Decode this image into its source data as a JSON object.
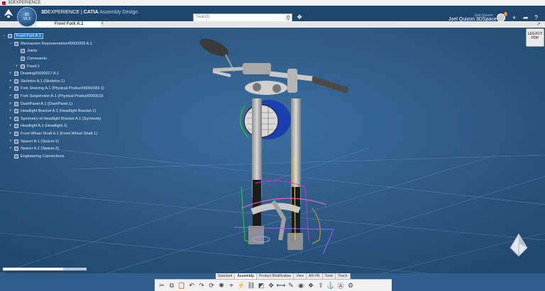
{
  "window_title": "3DEXPERIENCE",
  "header": {
    "brand_bold": "3D",
    "brand_rest": "EXPERIENCE",
    "separator": " | ",
    "product": "CATIA",
    "app": "Assembly Design",
    "app_badge": "3D\nV1.6",
    "search_placeholder": "Search",
    "user_small": "Joel Quizon",
    "user_name": "Joel Quizon 3DSpace",
    "notification_count": "1"
  },
  "tab": {
    "label": "Front Fork A.1"
  },
  "tree": {
    "root": "Front Fork A.1",
    "items": [
      {
        "label": "Mechanism Representation00000005 A.1",
        "indent": 1,
        "expand": "−",
        "icon": "mechanism-icon"
      },
      {
        "label": "Joints",
        "indent": 2,
        "expand": "",
        "icon": "joints-icon"
      },
      {
        "label": "Commands",
        "indent": 2,
        "expand": "",
        "icon": "commands-icon"
      },
      {
        "label": "Fixed.1",
        "indent": 2,
        "expand": "+",
        "icon": "fixed-icon"
      },
      {
        "label": "Drawing00000017 A.1",
        "indent": 1,
        "expand": "+",
        "icon": "drawing-icon"
      },
      {
        "label": "Skeleton A.1 (Skeleton.1)",
        "indent": 1,
        "expand": "+",
        "icon": "skeleton-icon"
      },
      {
        "label": "Fork Steering A.1 (Physical Product00001583.1)",
        "indent": 1,
        "expand": "+",
        "icon": "product-icon"
      },
      {
        "label": "Fork Suspension A.1 (Physical Product0000015",
        "indent": 1,
        "expand": "+",
        "icon": "product-icon"
      },
      {
        "label": "DashPanel A.1 (DashPanel.1)",
        "indent": 1,
        "expand": "+",
        "icon": "product-icon"
      },
      {
        "label": "Headlight Bracket A.1 (Headlight Bracket.1)",
        "indent": 1,
        "expand": "+",
        "icon": "product-icon"
      },
      {
        "label": "Symmetry of Headlight Bracket A.1 (Symmetry",
        "indent": 1,
        "expand": "+",
        "icon": "symmetry-icon"
      },
      {
        "label": "Headlight A.1 (Headlight.1)",
        "indent": 1,
        "expand": "+",
        "icon": "product-icon"
      },
      {
        "label": "Front Wheel Shaft A.1 (Front Wheel Shaft.1)",
        "indent": 1,
        "expand": "+",
        "icon": "product-icon"
      },
      {
        "label": "Spacer A.1 (Spacer.1)",
        "indent": 1,
        "expand": "+",
        "icon": "product-icon"
      },
      {
        "label": "Spacer A.1 (Spacer.3)",
        "indent": 1,
        "expand": "+",
        "icon": "product-icon"
      },
      {
        "label": "Engineering Connections",
        "indent": 1,
        "expand": "",
        "icon": "connections-icon"
      }
    ]
  },
  "legacy_button": "LEGACY\nPDP",
  "slider_level": 0.72,
  "bottom_tabs": [
    "Standard",
    "Assembly",
    "Product Modification",
    "View",
    "AR-VR",
    "Tools",
    "Touch"
  ],
  "active_tab": "Assembly",
  "toolbar_icons": [
    "cut-icon",
    "copy-icon",
    "paste-icon",
    "undo-icon",
    "redo-icon",
    "update-icon",
    "explode-icon",
    "snap-icon",
    "clash-icon",
    "engineering-connection-icon",
    "section-icon",
    "compass-icon",
    "measure-icon",
    "annotation-icon",
    "visibility-icon",
    "flexible-icon",
    "publish-icon",
    "fix-icon",
    "rename-icon",
    "settings-icon"
  ],
  "colors": {
    "viewport_bg": "#2f5d8c",
    "top_bar": "#1e466e",
    "selected": "#1e6fe0"
  }
}
